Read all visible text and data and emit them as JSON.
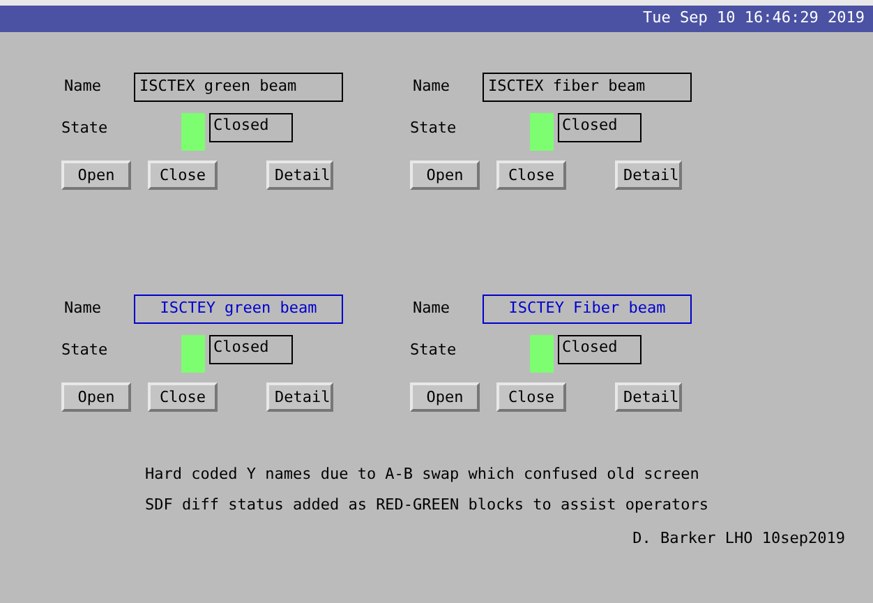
{
  "title_bar": {
    "clock": "Tue Sep 10 16:46:29 2019"
  },
  "panels": [
    {
      "name_label": "Name",
      "name": {
        "text": "ISCTEX green beam",
        "kind": "static",
        "color": "#000000"
      },
      "state_label": "State",
      "state": {
        "color": "#7dfd70",
        "text": "Closed"
      },
      "buttons": [
        "Open",
        "Close",
        "Detail"
      ]
    },
    {
      "name_label": "Name",
      "name": {
        "text": "ISCTEX fiber beam",
        "kind": "static",
        "color": "#000000"
      },
      "state_label": "State",
      "state": {
        "color": "#7dfd70",
        "text": "Closed"
      },
      "buttons": [
        "Open",
        "Close",
        "Detail"
      ]
    },
    {
      "name_label": "Name",
      "name": {
        "text": "ISCTEY green beam",
        "kind": "centered",
        "color": "#0000cc"
      },
      "state_label": "State",
      "state": {
        "color": "#7dfd70",
        "text": "Closed"
      },
      "buttons": [
        "Open",
        "Close",
        "Detail"
      ]
    },
    {
      "name_label": "Name",
      "name": {
        "text": "ISCTEY Fiber beam",
        "kind": "centered",
        "color": "#0000cc"
      },
      "state_label": "State",
      "state": {
        "color": "#7dfd70",
        "text": "Closed"
      },
      "buttons": [
        "Open",
        "Close",
        "Detail"
      ]
    }
  ],
  "notes": [
    "Hard coded Y names due to A-B swap which confused old screen",
    "SDF diff status added as RED-GREEN blocks to assist operators"
  ],
  "signature": "D. Barker LHO 10sep2019"
}
